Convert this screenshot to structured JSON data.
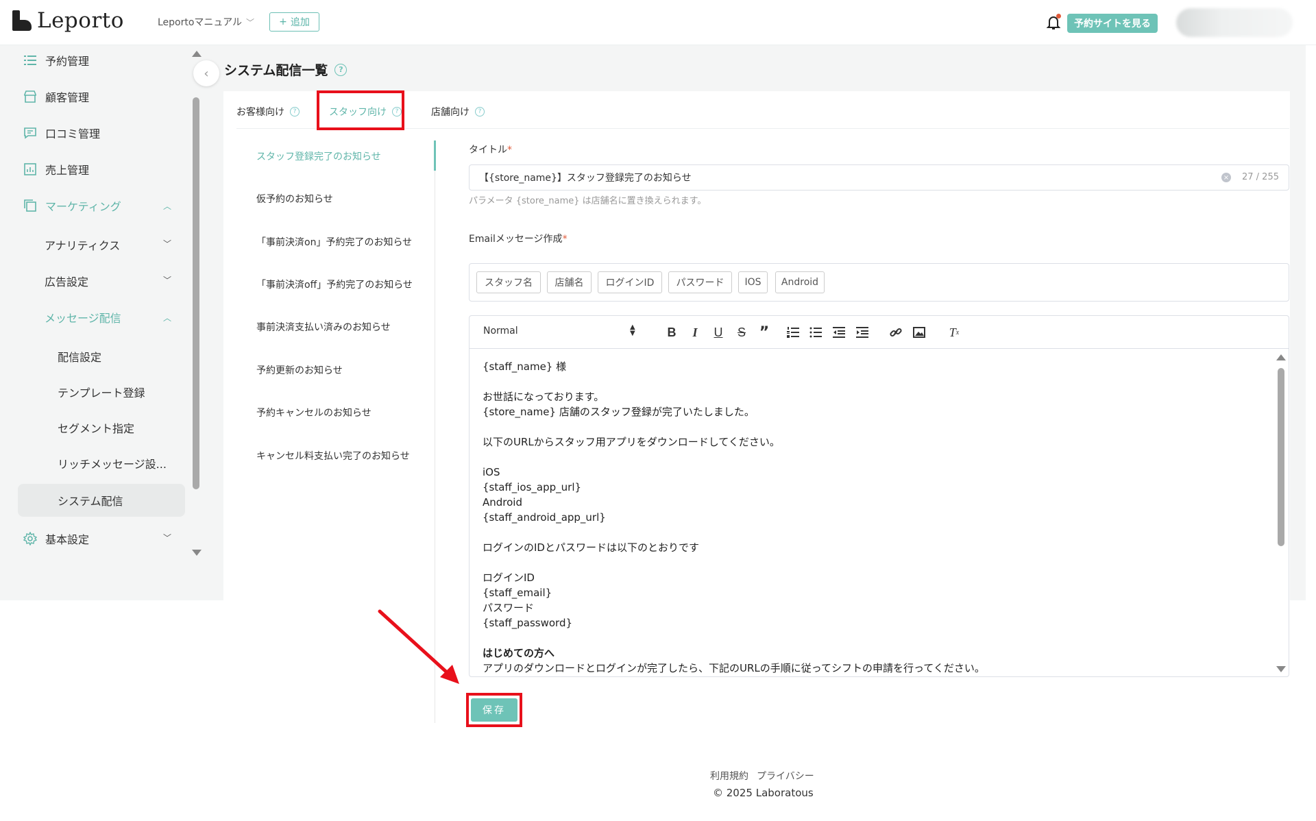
{
  "header": {
    "logo_text": "Leporto",
    "workspace": "Leportoマニュアル",
    "add_label": "追加",
    "view_site_label": "予約サイトを見る"
  },
  "sidebar": {
    "items": [
      {
        "label": "予約管理"
      },
      {
        "label": "顧客管理"
      },
      {
        "label": "口コミ管理"
      },
      {
        "label": "売上管理"
      },
      {
        "label": "マーケティング"
      },
      {
        "label": "アナリティクス"
      },
      {
        "label": "広告設定"
      },
      {
        "label": "メッセージ配信"
      },
      {
        "label": "配信設定"
      },
      {
        "label": "テンプレート登録"
      },
      {
        "label": "セグメント指定"
      },
      {
        "label": "リッチメッセージ設..."
      },
      {
        "label": "システム配信"
      },
      {
        "label": "基本設定"
      }
    ]
  },
  "page": {
    "title": "システム配信一覧",
    "tabs": [
      {
        "label": "お客様向け"
      },
      {
        "label": "スタッフ向け"
      },
      {
        "label": "店舗向け"
      }
    ]
  },
  "templates": [
    {
      "label": "スタッフ登録完了のお知らせ"
    },
    {
      "label": "仮予約のお知らせ"
    },
    {
      "label": "「事前決済on」予約完了のお知らせ"
    },
    {
      "label": "「事前決済off」予約完了のお知らせ"
    },
    {
      "label": "事前決済支払い済みのお知らせ"
    },
    {
      "label": "予約更新のお知らせ"
    },
    {
      "label": "予約キャンセルのお知らせ"
    },
    {
      "label": "キャンセル料支払い完了のお知らせ"
    }
  ],
  "form": {
    "title_label": "タイトル",
    "required_mark": "*",
    "title_value": "【{store_name}】スタッフ登録完了のお知らせ",
    "title_count": "27 / 255",
    "title_hint": "パラメータ {store_name} は店舗名に置き換えられます。",
    "email_label": "Emailメッセージ作成",
    "tags": [
      "スタッフ名",
      "店舗名",
      "ログインID",
      "パスワード",
      "IOS",
      "Android"
    ],
    "format_select": "Normal",
    "body_lines": [
      "{staff_name} 様",
      "",
      "お世話になっております。",
      "{store_name} 店舗のスタッフ登録が完了いたしました。",
      "",
      "以下のURLからスタッフ用アプリをダウンロードしてください。",
      "",
      "iOS",
      "{staff_ios_app_url}",
      "Android",
      "{staff_android_app_url}",
      "",
      "ログインのIDとパスワードは以下のとおりです",
      "",
      "ログインID",
      "{staff_email}",
      "パスワード",
      "{staff_password}",
      "",
      "はじめての方へ",
      "アプリのダウンロードとログインが完了したら、下記のURLの手順に従ってシフトの申請を行ってください。"
    ],
    "save_label": "保存"
  },
  "footer": {
    "terms": "利用規約",
    "privacy": "プライバシー",
    "copyright": "© 2025 Laboratous"
  },
  "colors": {
    "accent": "#6ec3b7",
    "highlight_red": "#e8101b"
  }
}
